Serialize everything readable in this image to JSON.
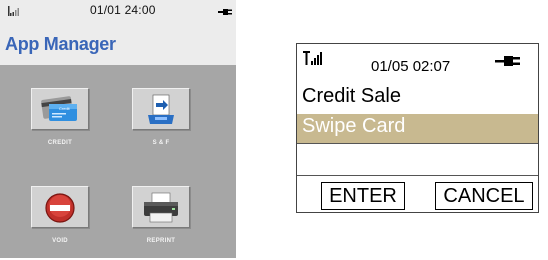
{
  "left_screen": {
    "status": {
      "time": "01/01  24:00",
      "signal_icon": "signal-icon",
      "power_icon": "plug-icon"
    },
    "title": "App Manager",
    "tiles": [
      {
        "label": "CREDIT",
        "icon": "credit-card-icon",
        "card_text": "Credit"
      },
      {
        "label": "S & F",
        "icon": "store-forward-icon"
      },
      {
        "label": "VOID",
        "icon": "no-entry-icon"
      },
      {
        "label": "REPRINT",
        "icon": "printer-icon"
      }
    ]
  },
  "right_screen": {
    "status": {
      "time": "01/05  02:07",
      "signal_icon": "signal-icon",
      "power_icon": "plug-icon"
    },
    "line1": "Credit Sale",
    "line2": "Swipe Card",
    "input_value": "",
    "buttons": {
      "enter": "ENTER",
      "cancel": "CANCEL"
    },
    "colors": {
      "highlight": "#c8b990"
    }
  }
}
